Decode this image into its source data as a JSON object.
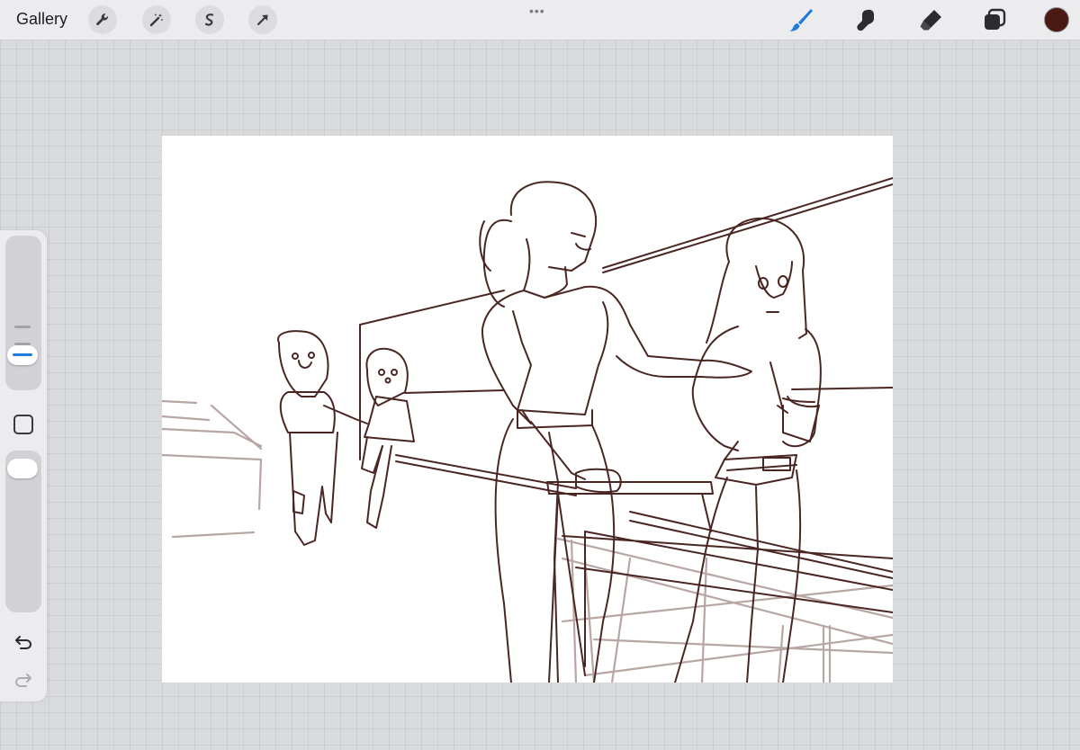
{
  "topbar": {
    "gallery_label": "Gallery",
    "more_dots": "•••",
    "left_tools": [
      "wrench-icon",
      "magic-wand-icon",
      "selection-icon",
      "transform-arrow-icon"
    ],
    "right_tools": [
      "brush-icon",
      "smudge-icon",
      "eraser-icon",
      "layers-icon"
    ],
    "active_tool": "brush-icon",
    "active_color": "#4a1a12"
  },
  "sidebar": {
    "controls": [
      "brush-size-slider",
      "modify-button",
      "opacity-slider",
      "undo-icon",
      "redo-icon"
    ]
  },
  "canvas": {
    "stroke_color": "#4a2622",
    "sketch_color": "#b8a6a4"
  },
  "colors": {
    "accent": "#1f7ae0",
    "toolbar": "#ececee"
  }
}
